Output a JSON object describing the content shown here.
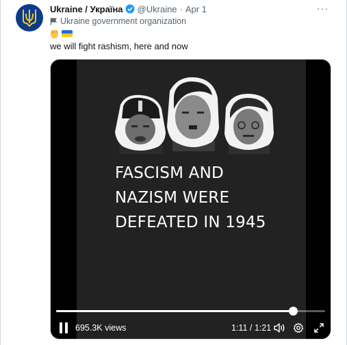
{
  "tweet": {
    "display_name": "Ukraine / Україна",
    "handle": "@Ukraine",
    "separator": "·",
    "date": "Apr 1",
    "org_label": "Ukraine government organization",
    "text": "we will fight rashism, here and now",
    "more_label": "···"
  },
  "video": {
    "headline_lines": [
      "FASCISM AND",
      "NAZISM WERE",
      "DEFEATED IN 1945"
    ],
    "views": "695.3K views",
    "time": "1:11 / 1:21",
    "progress": 0.88
  },
  "icons": {
    "avatar": "ukraine-trident-icon",
    "verified": "verified-badge-icon",
    "org": "flag-icon",
    "more": "more-icon",
    "pause": "pause-icon",
    "volume": "volume-icon",
    "settings": "gear-icon",
    "fullscreen": "fullscreen-icon"
  },
  "colors": {
    "avatar_bg": "#0d3b8c",
    "trident": "#f5cc1d",
    "verified": "#1d9bf0",
    "text_secondary": "#536471",
    "video_bg": "#222222"
  }
}
